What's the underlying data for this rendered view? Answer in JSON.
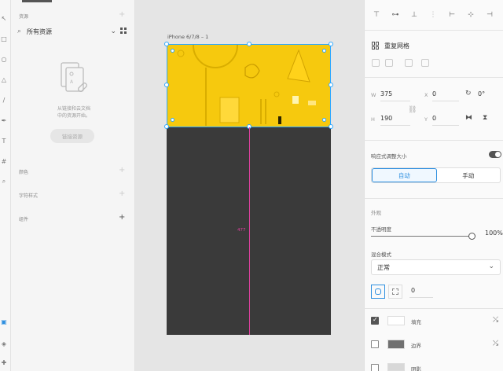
{
  "assets": {
    "section_title": "资源",
    "filter_label": "所有资源",
    "empty_text_line1": "从链接和云文档",
    "empty_text_line2": "中的资源开始。",
    "link_button": "链接资源",
    "colors_label": "颜色",
    "char_styles_label": "字符样式",
    "components_label": "组件"
  },
  "canvas": {
    "artboard_label": "iPhone 6/7/8 – 1",
    "guide_value": "477"
  },
  "props": {
    "repeat_grid_label": "重复网格",
    "w_label": "W",
    "w_value": "375",
    "x_label": "X",
    "x_value": "0",
    "rotation_value": "0°",
    "h_label": "H",
    "h_value": "190",
    "y_label": "Y",
    "y_value": "0",
    "responsive_label": "响应式调整大小",
    "auto_label": "自动",
    "manual_label": "手动",
    "appearance_label": "外观",
    "opacity_label": "不透明度",
    "opacity_value": "100%",
    "blend_label": "混合模式",
    "blend_value": "正常",
    "corner_value": "0",
    "fill_label": "填充",
    "border_label": "边界",
    "shadow_label": "阴影"
  },
  "colors": {
    "accent": "#2d8fe0",
    "artboard_fill": "#f6c90e",
    "artboard_dark": "#3a3a3a",
    "guide": "#e040a0"
  }
}
